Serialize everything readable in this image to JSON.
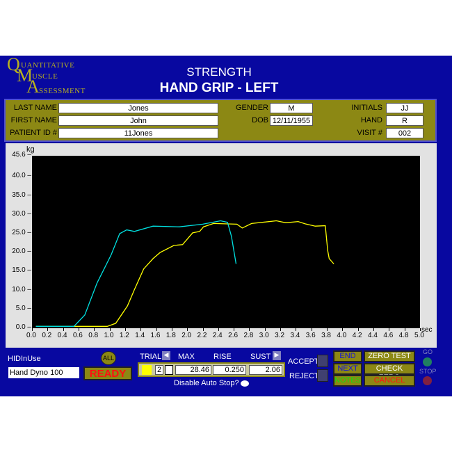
{
  "logo": {
    "q": "Q",
    "uantitative": "UANTITATIVE",
    "m": "M",
    "uscle": "USCLE",
    "a": "A",
    "ssessment": "SSESSMENT"
  },
  "header": {
    "title": "STRENGTH",
    "subtitle": "HAND GRIP - LEFT"
  },
  "patient": {
    "last_name_label": "LAST NAME",
    "last_name": "Jones",
    "first_name_label": "FIRST NAME",
    "first_name": "John",
    "patient_id_label": "PATIENT ID #",
    "patient_id": "11Jones",
    "gender_label": "GENDER",
    "gender": "M",
    "dob_label": "DOB",
    "dob": "12/11/1955",
    "initials_label": "INITIALS",
    "initials": "JJ",
    "hand_label": "HAND",
    "hand": "R",
    "visit_label": "VISIT #",
    "visit": "002"
  },
  "chart_data": {
    "type": "line",
    "ylabel": "kg",
    "xlabel": "sec",
    "xlim": [
      0,
      5
    ],
    "ylim": [
      0,
      45.6
    ],
    "yticks": [
      "0.0",
      "5.0",
      "10.0",
      "15.0",
      "20.0",
      "25.0",
      "30.0",
      "35.0",
      "40.0",
      "45.6"
    ],
    "xticks": [
      "0.0",
      "0.2",
      "0.4",
      "0.6",
      "0.8",
      "1.0",
      "1.2",
      "1.4",
      "1.6",
      "1.8",
      "2.0",
      "2.2",
      "2.4",
      "2.6",
      "2.8",
      "3.0",
      "3.2",
      "3.4",
      "3.6",
      "3.8",
      "4.0",
      "4.2",
      "4.4",
      "4.6",
      "4.8",
      "5.0"
    ],
    "series": [
      {
        "id": "trace_1",
        "color": "#ffff00",
        "x": [
          0.05,
          0.97,
          1.08,
          1.23,
          1.32,
          1.44,
          1.56,
          1.65,
          1.83,
          1.94,
          2.07,
          2.16,
          2.21,
          2.34,
          2.64,
          2.71,
          2.83,
          3.15,
          3.27,
          3.43,
          3.52,
          3.65,
          3.78,
          3.81,
          3.83,
          3.89
        ],
        "y": [
          0.5,
          0.5,
          1.3,
          5.9,
          10.2,
          15.7,
          18.4,
          20,
          21.9,
          22.1,
          25.2,
          25.6,
          26.8,
          27.7,
          27.5,
          26.5,
          27.7,
          28.4,
          27.9,
          28.2,
          27.6,
          27.0,
          27.1,
          20.6,
          18.4,
          17
        ]
      },
      {
        "id": "trace_2",
        "color": "#00e0e0",
        "x": [
          0.05,
          0.54,
          0.68,
          0.84,
          0.93,
          1.02,
          1.13,
          1.22,
          1.32,
          1.56,
          1.9,
          2.2,
          2.43,
          2.52,
          2.57,
          2.63
        ],
        "y": [
          0.5,
          0.5,
          3.5,
          12,
          15.7,
          19.4,
          25,
          26,
          25.6,
          27,
          26.8,
          27.5,
          28.4,
          28,
          24.3,
          17
        ]
      }
    ]
  },
  "controls": {
    "device_label": "HIDInUse",
    "device": "Hand Dyno 100",
    "all": "ALL",
    "ready": "READY",
    "trial_label": "TRIAL",
    "max_label": "MAX",
    "rise_label": "RISE",
    "sust_label": "SUST",
    "trial": "2",
    "max": "28.46",
    "rise": "0.250",
    "sust": "2.06",
    "disable_auto_stop": "Disable Auto Stop?",
    "accept": "ACCEPT",
    "reject": "REJECT",
    "end": "END",
    "next": "NEXT",
    "notes": "NOTES",
    "zero_test": "ZERO TEST",
    "check_zero": "CHECK ZERO",
    "cancel": "CANCEL",
    "go": "GO",
    "stop": "STOP"
  }
}
